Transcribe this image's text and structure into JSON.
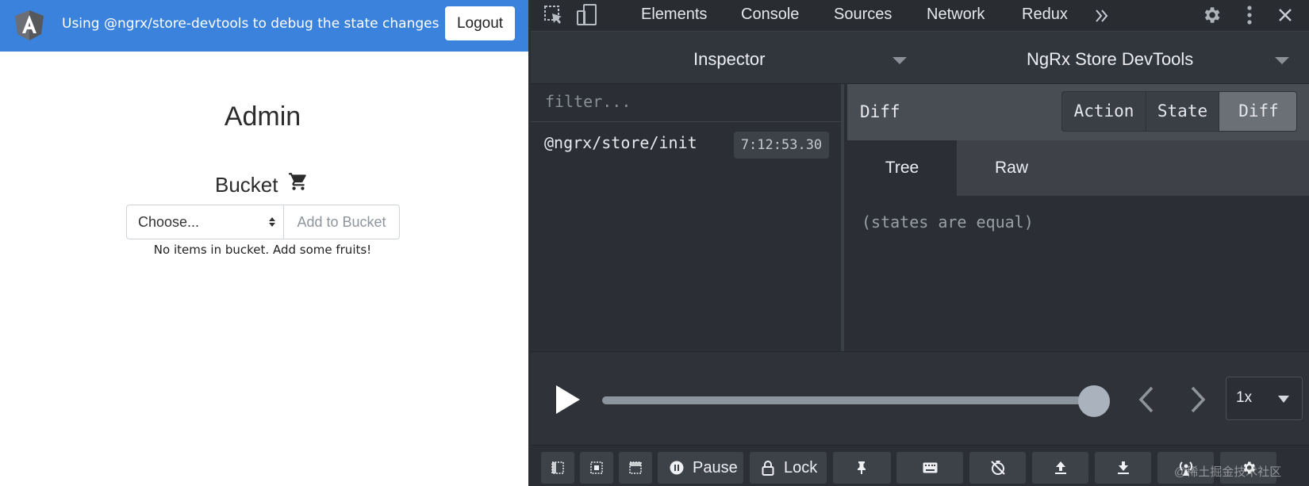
{
  "app": {
    "header_title": "Using @ngrx/store-devtools to debug the state changes",
    "logout_label": "Logout",
    "heading": "Admin",
    "bucket_heading": "Bucket",
    "select_value": "Choose...",
    "add_button_label": "Add to Bucket",
    "empty_message": "No items in bucket. Add some fruits!",
    "accent_color": "#3b82dd"
  },
  "devtools": {
    "tabs": [
      "Elements",
      "Console",
      "Sources",
      "Network",
      "Redux"
    ],
    "more_tabs_icon": "double-chevron-icon",
    "panel_selector": "Inspector",
    "instance_selector": "NgRx Store DevTools",
    "filter_placeholder": "filter...",
    "actions": [
      {
        "name": "@ngrx/store/init",
        "time": "7:12:53.30"
      }
    ],
    "monitor": {
      "title": "Diff",
      "modes": [
        "Action",
        "State",
        "Diff"
      ],
      "active_mode": "Diff",
      "views": [
        "Tree",
        "Raw"
      ],
      "active_view": "Tree",
      "message": "(states are equal)"
    },
    "slider": {
      "position": 1.0,
      "speed": "1x"
    },
    "toolbar": {
      "pause_label": "Pause",
      "lock_label": "Lock"
    }
  },
  "watermark": "@稀土掘金技术社区"
}
